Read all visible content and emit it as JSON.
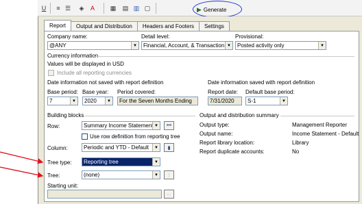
{
  "toolbar": {
    "generate_label": "Generate",
    "icons": [
      "underline-icon",
      "align-icon",
      "align-center-icon",
      "fill-color-icon",
      "font-color-icon",
      "grid-icon",
      "table-icon",
      "columns-icon",
      "page-icon",
      "generate-icon"
    ]
  },
  "tabs": [
    "Report",
    "Output and Distribution",
    "Headers and Footers",
    "Settings"
  ],
  "company": {
    "label": "Company name:",
    "value": "@ANY"
  },
  "detail": {
    "label": "Detail level:",
    "value": "Financial, Account, & Transaction"
  },
  "provisional": {
    "label": "Provisional:",
    "value": "Posted activity only"
  },
  "currency": {
    "heading": "Currency information",
    "text": "Values will be displayed in USD",
    "include_all_label": "Include all reporting currencies"
  },
  "date_not_saved": {
    "heading": "Date information not saved with report definition",
    "base_period_label": "Base period:",
    "base_period_value": "7",
    "base_year_label": "Base year:",
    "base_year_value": "2020",
    "period_covered_label": "Period covered:",
    "period_covered_value": "For the Seven Months Ending"
  },
  "date_saved": {
    "heading": "Date information saved with report definition",
    "report_date_label": "Report date:",
    "report_date_value": "7/31/2020",
    "default_base_label": "Default base period:",
    "default_base_value": "S-1"
  },
  "building_blocks": {
    "heading": "Building blocks",
    "row_label": "Row:",
    "row_value": "Summary Income Statement - D",
    "use_row_label": "Use row definition from reporting tree",
    "column_label": "Column:",
    "column_value": "Periodic and YTD - Default",
    "tree_type_label": "Tree type:",
    "tree_type_value": "Reporting tree",
    "tree_label": "Tree:",
    "tree_value": "(none)",
    "starting_unit_label": "Starting unit:",
    "starting_unit_value": ""
  },
  "output_summary": {
    "heading": "Output and distribution summary",
    "rows": [
      {
        "label": "Output type:",
        "value": "Management Reporter"
      },
      {
        "label": "Output name:",
        "value": "Income Statement - Default"
      },
      {
        "label": "Report library location:",
        "value": "Library"
      },
      {
        "label": "Report duplicate accounts:",
        "value": "No"
      }
    ]
  },
  "colors": {
    "annotation_red": "#e0141c",
    "highlight_blue": "#2433d6",
    "selection": "#0a246a"
  }
}
